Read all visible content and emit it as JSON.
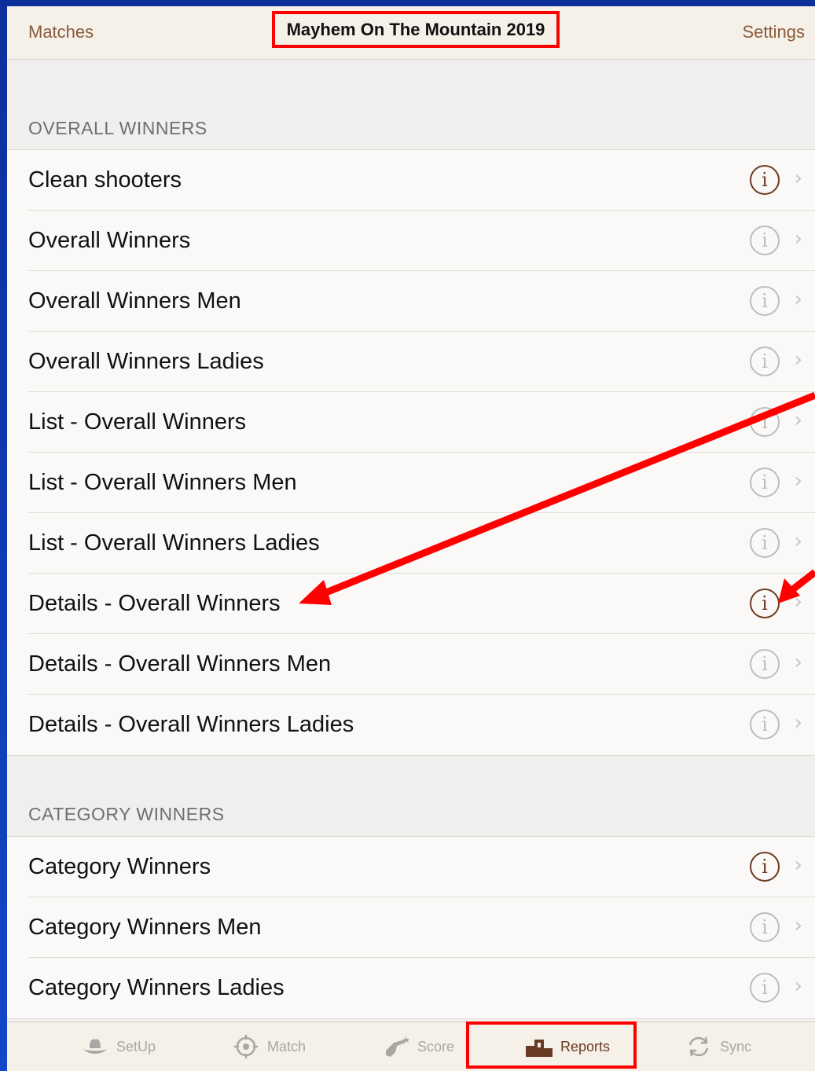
{
  "navbar": {
    "back_label": "Matches",
    "title": "Mayhem On The Mountain 2019",
    "settings_label": "Settings"
  },
  "sections": [
    {
      "header": "OVERALL WINNERS",
      "rows": [
        {
          "label": "Clean shooters",
          "info_active": true
        },
        {
          "label": "Overall Winners",
          "info_active": false
        },
        {
          "label": "Overall Winners Men",
          "info_active": false
        },
        {
          "label": "Overall Winners Ladies",
          "info_active": false
        },
        {
          "label": "List - Overall Winners",
          "info_active": false
        },
        {
          "label": "List - Overall Winners Men",
          "info_active": false
        },
        {
          "label": "List - Overall Winners Ladies",
          "info_active": false
        },
        {
          "label": "Details - Overall Winners",
          "info_active": true
        },
        {
          "label": "Details - Overall Winners Men",
          "info_active": false
        },
        {
          "label": "Details - Overall Winners Ladies",
          "info_active": false
        }
      ]
    },
    {
      "header": "CATEGORY WINNERS",
      "rows": [
        {
          "label": "Category Winners",
          "info_active": true
        },
        {
          "label": "Category Winners Men",
          "info_active": false
        },
        {
          "label": "Category Winners Ladies",
          "info_active": false
        }
      ]
    }
  ],
  "icons": {
    "info": "info-icon",
    "chevron": "chevron-right-icon"
  },
  "info_glyph": "i",
  "chevron_glyph": "›",
  "tabs": [
    {
      "label": "SetUp",
      "icon": "cowboy-hat-icon",
      "active": false
    },
    {
      "label": "Match",
      "icon": "target-icon",
      "active": false
    },
    {
      "label": "Score",
      "icon": "revolver-icon",
      "active": false
    },
    {
      "label": "Reports",
      "icon": "podium-icon",
      "active": true
    },
    {
      "label": "Sync",
      "icon": "sync-icon",
      "active": false
    }
  ],
  "colors": {
    "accent": "#6b3a22",
    "nav_text": "#8a5a3a",
    "inactive": "#a9a7a3",
    "highlight": "#ff0000"
  }
}
